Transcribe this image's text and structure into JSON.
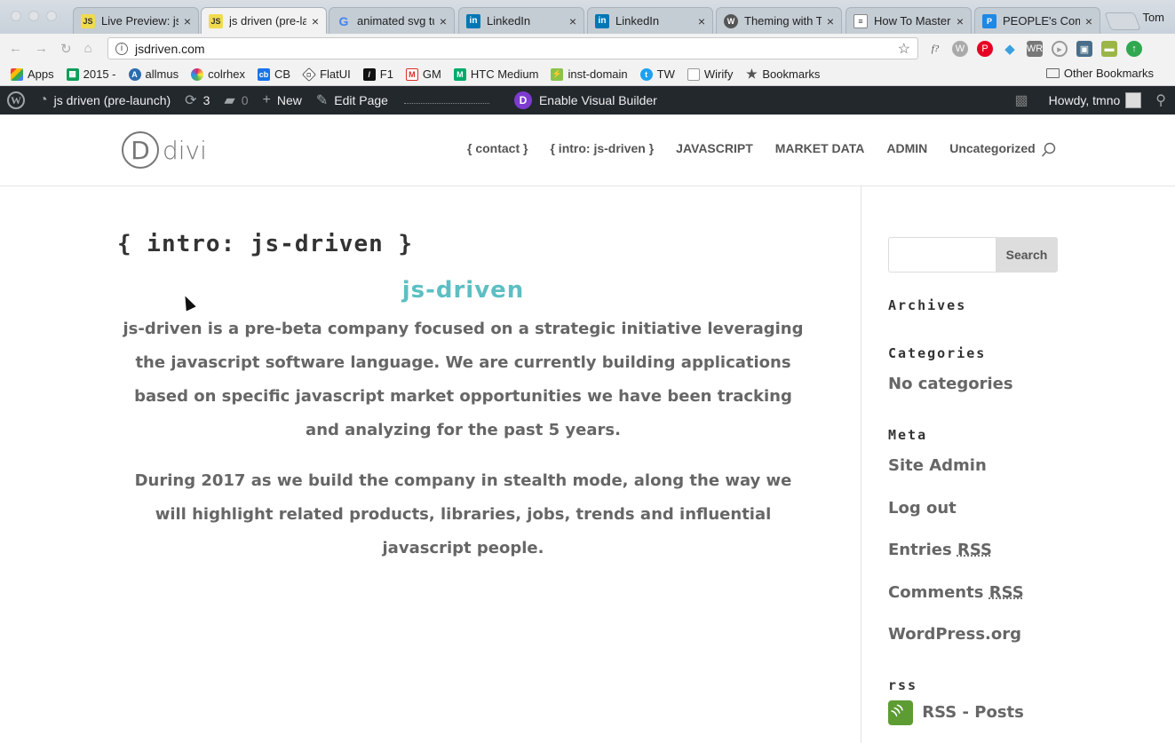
{
  "browser": {
    "tabs": [
      {
        "title": "Live Preview: js",
        "favicon": "js",
        "active": false
      },
      {
        "title": "js driven (pre-la",
        "favicon": "js",
        "active": true
      },
      {
        "title": "animated svg tu",
        "favicon": "google",
        "active": false
      },
      {
        "title": "LinkedIn",
        "favicon": "linkedin",
        "active": false
      },
      {
        "title": "LinkedIn",
        "favicon": "linkedin",
        "active": false
      },
      {
        "title": "Theming with Tv",
        "favicon": "wordpress",
        "active": false
      },
      {
        "title": "How To Master",
        "favicon": "doc",
        "active": false
      },
      {
        "title": "PEOPLE's Comp",
        "favicon": "p",
        "active": false
      }
    ],
    "profile_name": "Tom",
    "url": "jsdriven.com",
    "bookmarks": [
      "Apps",
      "2015 -",
      "allmus",
      "colrhex",
      "CB",
      "FlatUI",
      "F1",
      "GM",
      "HTC Medium",
      "inst-domain",
      "TW",
      "Wirify",
      "Bookmarks"
    ],
    "other_bookmarks": "Other Bookmarks"
  },
  "adminbar": {
    "site_name": "js driven (pre-launch)",
    "updates_count": "3",
    "comments_count": "0",
    "new_label": "New",
    "edit_label": "Edit Page",
    "visual_builder_label": "Enable Visual Builder",
    "greeting": "Howdy, tmno"
  },
  "site": {
    "logo_text": "divi",
    "logo_letter": "D",
    "nav": [
      "{ contact }",
      "{ intro: js-driven }",
      "JAVASCRIPT",
      "MARKET DATA",
      "ADMIN",
      "Uncategorized"
    ]
  },
  "page": {
    "title": "{ intro: js-driven }",
    "heading": "js-driven",
    "para1": "js-driven is a pre-beta company focused on a strategic initiative leveraging the javascript software language. We are currently building applications based on specific javascript market opportunities we have been tracking and analyzing for the past 5 years.",
    "para2": "During 2017 as we build the company in stealth mode, along the way we will highlight related products, libraries, jobs, trends and influential javascript people."
  },
  "sidebar": {
    "search_button": "Search",
    "archives_heading": "Archives",
    "categories_heading": "Categories",
    "no_categories": "No categories",
    "meta_heading": "Meta",
    "meta_links": [
      "Site Admin",
      "Log out",
      "Entries",
      "Comments",
      "WordPress.org"
    ],
    "rss_abbr": "RSS",
    "rss_heading": "rss",
    "rss_posts": "RSS - Posts"
  },
  "colors": {
    "admin_bar": "#23282d",
    "heading_accent": "#5cbfc3",
    "body_text": "#666666"
  }
}
